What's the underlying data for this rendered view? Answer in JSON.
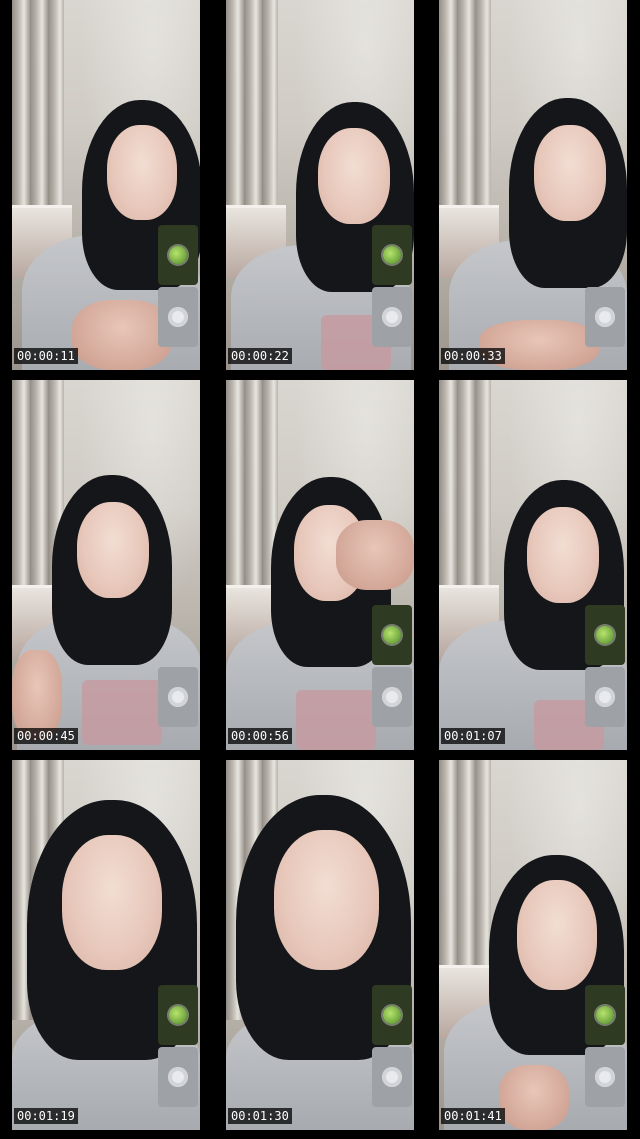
{
  "frames": [
    {
      "timestamp": "00:00:11",
      "overlay": "both"
    },
    {
      "timestamp": "00:00:22",
      "overlay": "both"
    },
    {
      "timestamp": "00:00:33",
      "overlay": "button_only"
    },
    {
      "timestamp": "00:00:45",
      "overlay": "button_only"
    },
    {
      "timestamp": "00:00:56",
      "overlay": "both"
    },
    {
      "timestamp": "00:01:07",
      "overlay": "both"
    },
    {
      "timestamp": "00:01:19",
      "overlay": "both"
    },
    {
      "timestamp": "00:01:30",
      "overlay": "both"
    },
    {
      "timestamp": "00:01:41",
      "overlay": "both"
    }
  ],
  "icons": {
    "thumbnail": "green-leaf-thumbnail-icon",
    "control": "circle-button-icon"
  },
  "colors": {
    "background": "#000000",
    "timestamp_text": "#ffffff",
    "overlay_button": "#9ea1a6",
    "overlay_thumb": "#2f3a22"
  }
}
